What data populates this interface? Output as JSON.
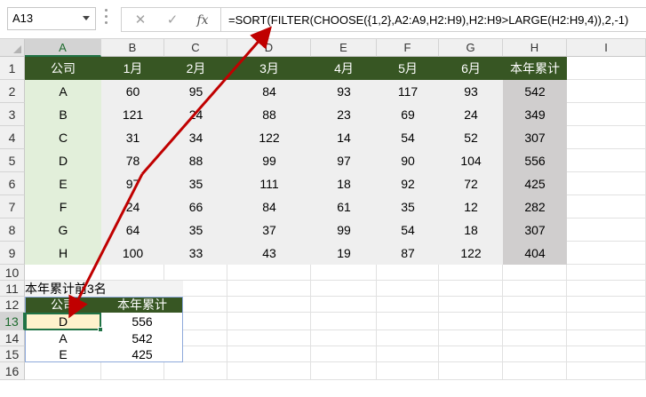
{
  "formula_bar": {
    "name_box": "A13",
    "cancel_icon": "✕",
    "enter_icon": "✓",
    "fx_label": "fx",
    "formula": "=SORT(FILTER(CHOOSE({1,2},A2:A9,H2:H9),H2:H9>LARGE(H2:H9,4)),2,-1)"
  },
  "columns": [
    "A",
    "B",
    "C",
    "D",
    "E",
    "F",
    "G",
    "H",
    "I"
  ],
  "rows": [
    "1",
    "2",
    "3",
    "4",
    "5",
    "6",
    "7",
    "8",
    "9",
    "10",
    "11",
    "12",
    "13",
    "14",
    "15",
    "16"
  ],
  "table1": {
    "headers": [
      "公司",
      "1月",
      "2月",
      "3月",
      "4月",
      "5月",
      "6月",
      "本年累计"
    ],
    "rows": [
      [
        "A",
        "60",
        "95",
        "84",
        "93",
        "117",
        "93",
        "542"
      ],
      [
        "B",
        "121",
        "24",
        "88",
        "23",
        "69",
        "24",
        "349"
      ],
      [
        "C",
        "31",
        "34",
        "122",
        "14",
        "54",
        "52",
        "307"
      ],
      [
        "D",
        "78",
        "88",
        "99",
        "97",
        "90",
        "104",
        "556"
      ],
      [
        "E",
        "97",
        "35",
        "111",
        "18",
        "92",
        "72",
        "425"
      ],
      [
        "F",
        "24",
        "66",
        "84",
        "61",
        "35",
        "12",
        "282"
      ],
      [
        "G",
        "64",
        "35",
        "37",
        "99",
        "54",
        "18",
        "307"
      ],
      [
        "H",
        "100",
        "33",
        "43",
        "19",
        "87",
        "122",
        "404"
      ]
    ]
  },
  "table2": {
    "title": "本年累计前3名",
    "headers": [
      "公司",
      "本年累计"
    ],
    "rows": [
      [
        "D",
        "556"
      ],
      [
        "A",
        "542"
      ],
      [
        "E",
        "425"
      ]
    ]
  },
  "colors": {
    "header_green": "#375623",
    "col_a_light_green": "#e2efda",
    "data_gray": "#efefef",
    "total_gray": "#d0cece",
    "arrow_red": "#c00000",
    "selection_green": "#217346"
  }
}
